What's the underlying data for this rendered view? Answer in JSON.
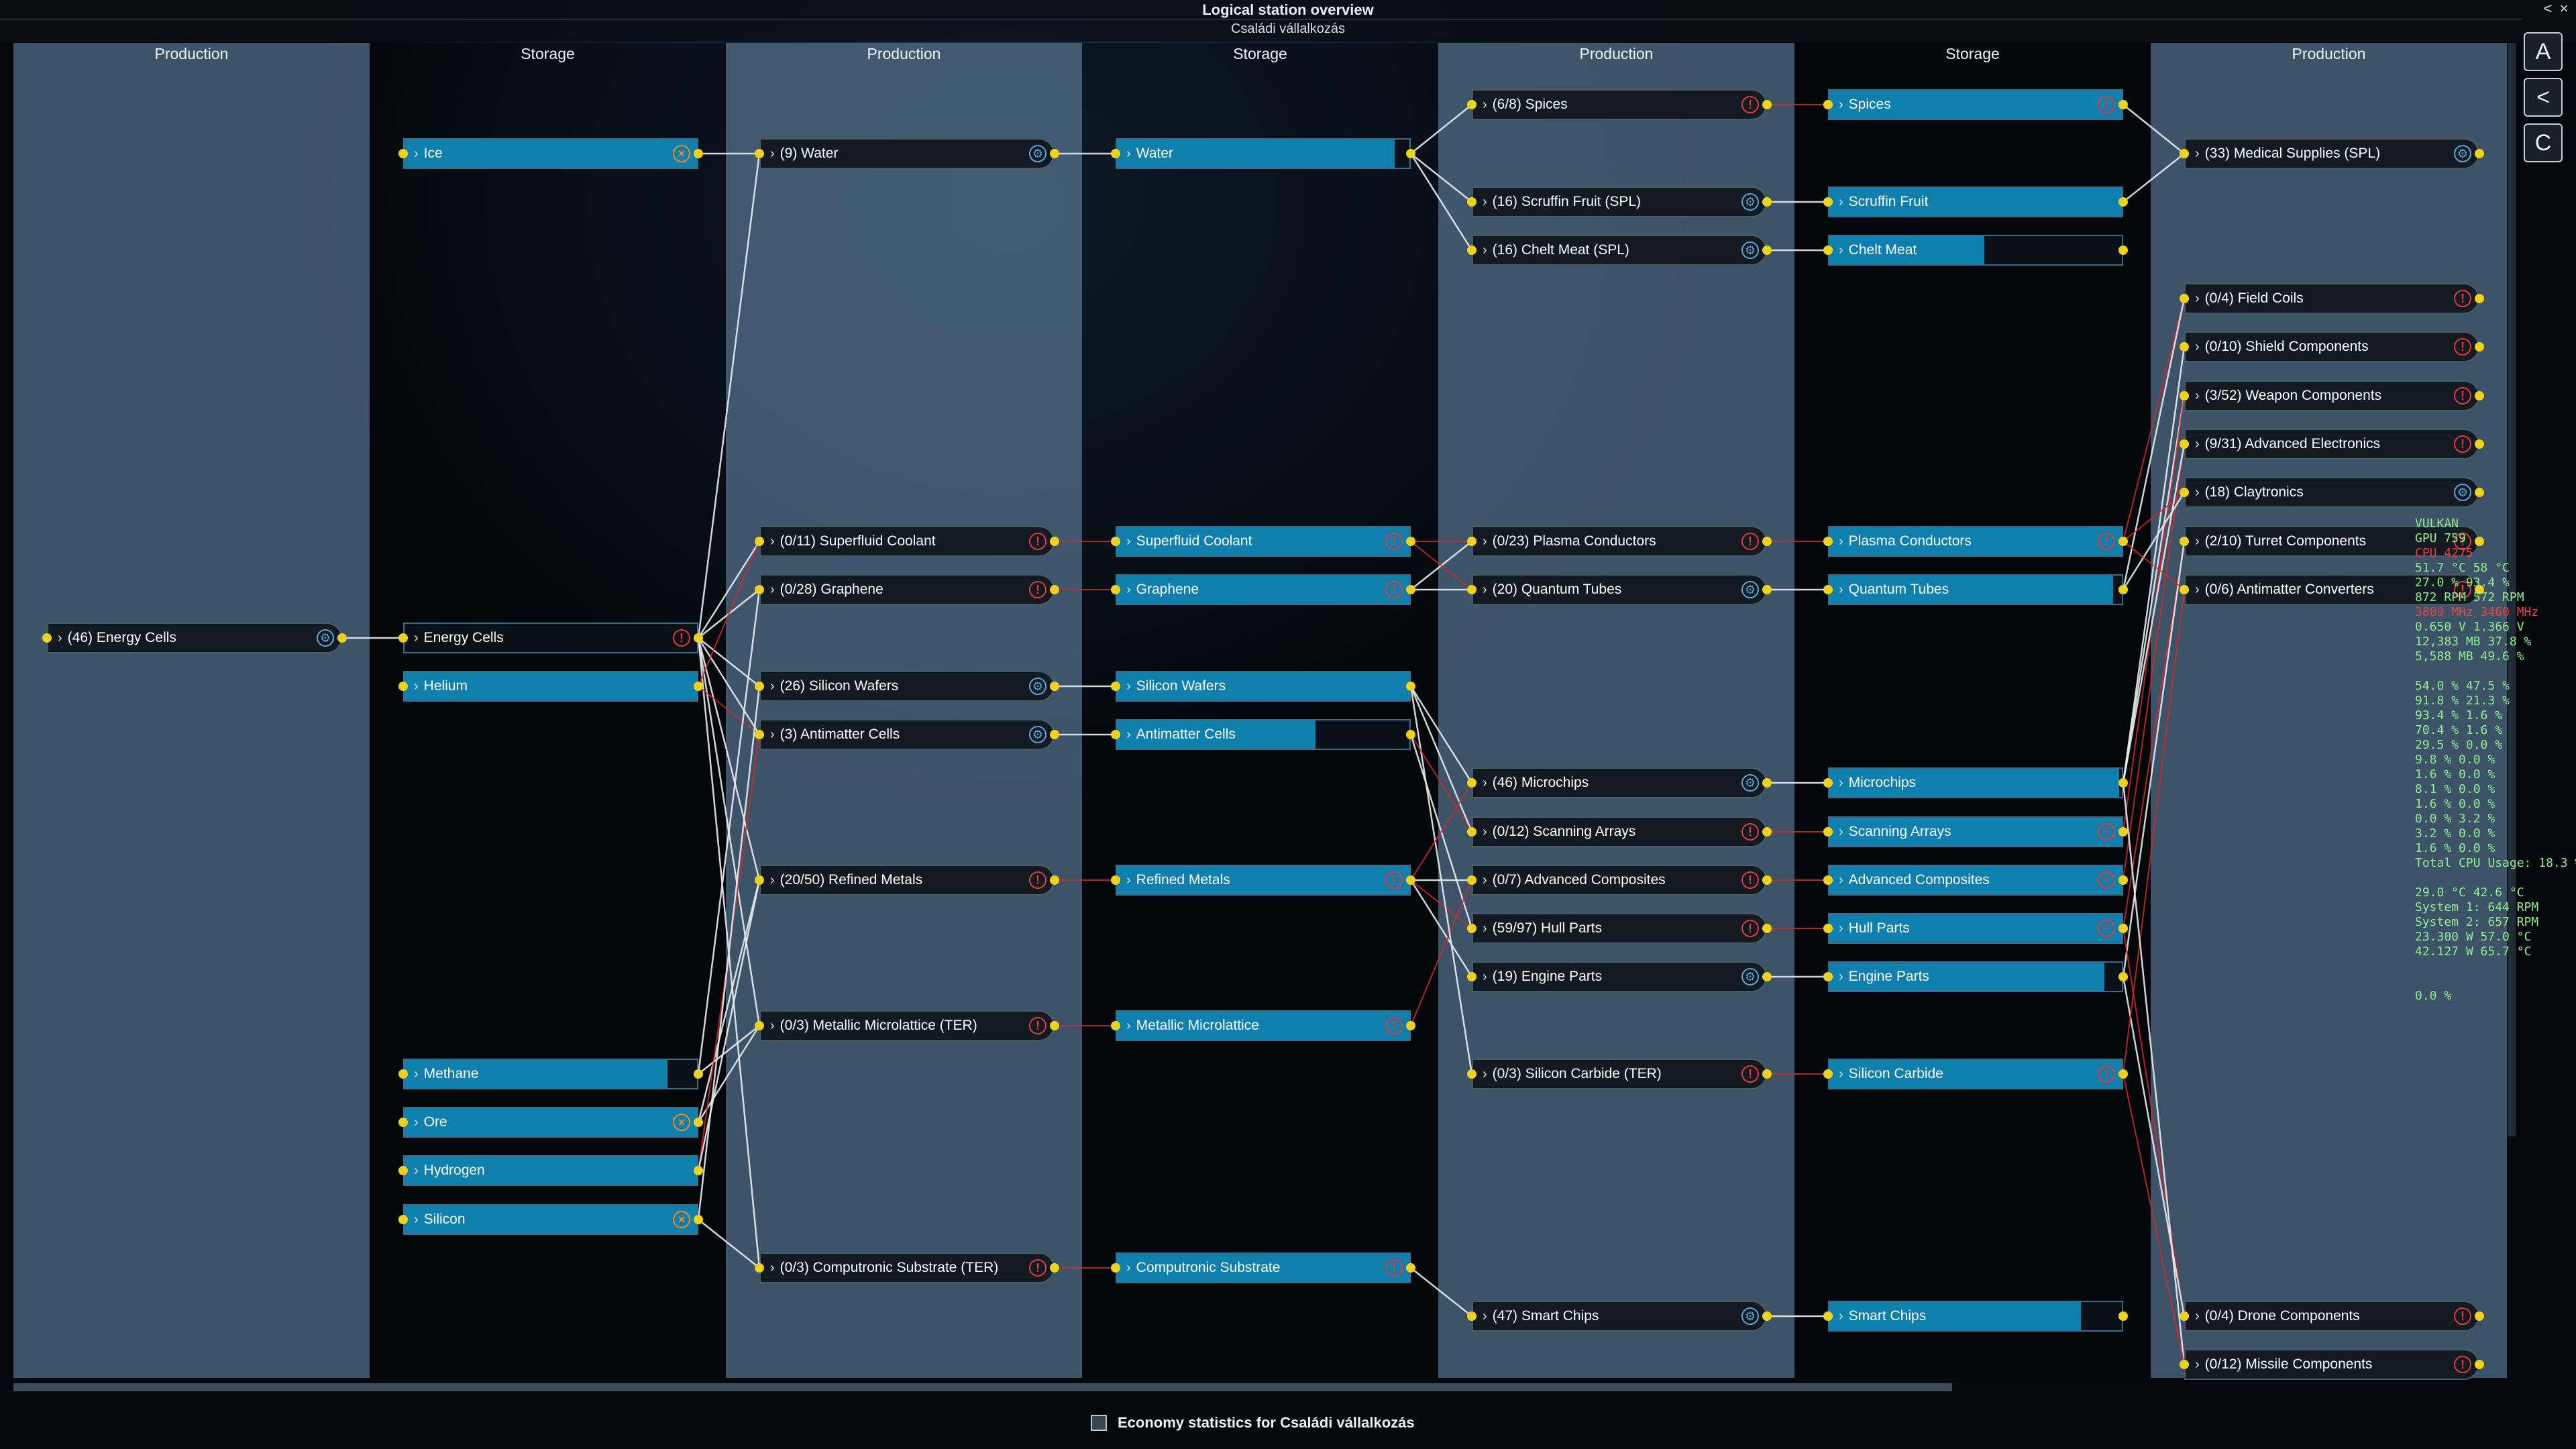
{
  "window": {
    "title": "Logical station overview",
    "subtitle": "Családi vállalkozás",
    "back_glyph": "<",
    "close_glyph": "×"
  },
  "columns": [
    {
      "label": "Production"
    },
    {
      "label": "Storage"
    },
    {
      "label": "Production"
    },
    {
      "label": "Storage"
    },
    {
      "label": "Production"
    },
    {
      "label": "Storage"
    },
    {
      "label": "Production"
    }
  ],
  "nodes": [
    {
      "label": "(46) Energy Cells",
      "status": "ok"
    },
    {
      "label": "Ice",
      "status": "x",
      "fill": 1.0
    },
    {
      "label": "Energy Cells",
      "status": "err",
      "fill": 0.0
    },
    {
      "label": "Helium",
      "status": "none",
      "fill": 1.0
    },
    {
      "label": "Methane",
      "status": "none",
      "fill": 0.9
    },
    {
      "label": "Ore",
      "status": "x",
      "fill": 1.0
    },
    {
      "label": "Hydrogen",
      "status": "none",
      "fill": 1.0
    },
    {
      "label": "Silicon",
      "status": "x",
      "fill": 1.0
    },
    {
      "label": "(9) Water",
      "status": "ok"
    },
    {
      "label": "(0/11) Superfluid Coolant",
      "status": "err"
    },
    {
      "label": "(0/28) Graphene",
      "status": "err"
    },
    {
      "label": "(26) Silicon Wafers",
      "status": "ok"
    },
    {
      "label": "(3) Antimatter Cells",
      "status": "ok"
    },
    {
      "label": "(20/50) Refined Metals",
      "status": "err"
    },
    {
      "label": "(0/3) Metallic Microlattice (TER)",
      "status": "err"
    },
    {
      "label": "(0/3) Computronic Substrate (TER)",
      "status": "err"
    },
    {
      "label": "Water",
      "status": "none",
      "fill": 0.95
    },
    {
      "label": "Superfluid Coolant",
      "status": "err",
      "fill": 1.0
    },
    {
      "label": "Graphene",
      "status": "err",
      "fill": 1.0
    },
    {
      "label": "Silicon Wafers",
      "status": "none",
      "fill": 1.0
    },
    {
      "label": "Antimatter Cells",
      "status": "none",
      "fill": 0.68
    },
    {
      "label": "Refined Metals",
      "status": "err",
      "fill": 1.0
    },
    {
      "label": "Metallic Microlattice",
      "status": "err",
      "fill": 1.0
    },
    {
      "label": "Computronic Substrate",
      "status": "err",
      "fill": 1.0
    },
    {
      "label": "(6/8) Spices",
      "status": "err"
    },
    {
      "label": "(16) Scruffin Fruit (SPL)",
      "status": "ok"
    },
    {
      "label": "(16) Chelt Meat (SPL)",
      "status": "ok"
    },
    {
      "label": "(0/23) Plasma Conductors",
      "status": "err"
    },
    {
      "label": "(20) Quantum Tubes",
      "status": "ok"
    },
    {
      "label": "(46) Microchips",
      "status": "ok"
    },
    {
      "label": "(0/12) Scanning Arrays",
      "status": "err"
    },
    {
      "label": "(0/7) Advanced Composites",
      "status": "err"
    },
    {
      "label": "(59/97) Hull Parts",
      "status": "err"
    },
    {
      "label": "(19) Engine Parts",
      "status": "ok"
    },
    {
      "label": "(0/3) Silicon Carbide (TER)",
      "status": "err"
    },
    {
      "label": "(47) Smart Chips",
      "status": "ok"
    },
    {
      "label": "Spices",
      "status": "err",
      "fill": 1.0
    },
    {
      "label": "Scruffin Fruit",
      "status": "none",
      "fill": 1.0
    },
    {
      "label": "Chelt Meat",
      "status": "none",
      "fill": 0.53
    },
    {
      "label": "Plasma Conductors",
      "status": "err",
      "fill": 1.0
    },
    {
      "label": "Quantum Tubes",
      "status": "none",
      "fill": 0.97
    },
    {
      "label": "Microchips",
      "status": "none",
      "fill": 0.99
    },
    {
      "label": "Scanning Arrays",
      "status": "err",
      "fill": 1.0
    },
    {
      "label": "Advanced Composites",
      "status": "err",
      "fill": 1.0
    },
    {
      "label": "Hull Parts",
      "status": "err",
      "fill": 1.0
    },
    {
      "label": "Engine Parts",
      "status": "none",
      "fill": 0.94
    },
    {
      "label": "Silicon Carbide",
      "status": "err",
      "fill": 1.0
    },
    {
      "label": "Smart Chips",
      "status": "none",
      "fill": 0.86
    },
    {
      "label": "(33) Medical Supplies (SPL)",
      "status": "ok"
    },
    {
      "label": "(0/4) Field Coils",
      "status": "err"
    },
    {
      "label": "(0/10) Shield Components",
      "status": "err"
    },
    {
      "label": "(3/52) Weapon Components",
      "status": "err"
    },
    {
      "label": "(9/31) Advanced Electronics",
      "status": "err"
    },
    {
      "label": "(18) Claytronics",
      "status": "ok"
    },
    {
      "label": "(2/10) Turret Components",
      "status": "err"
    },
    {
      "label": "(0/6) Antimatter Converters",
      "status": "err"
    },
    {
      "label": "(0/4) Drone Components",
      "status": "err"
    },
    {
      "label": "(0/12) Missile Components",
      "status": "err"
    }
  ],
  "side_buttons": [
    {
      "name": "autopilot-button",
      "glyph": "A"
    },
    {
      "name": "share-button",
      "glyph": "<"
    },
    {
      "name": "credits-button",
      "glyph": "C"
    }
  ],
  "overlay": {
    "title": "VULKAN",
    "lines": [
      "GPU     759",
      "CPU    4275",
      "51.7 °C 58 °C",
      "27.0 % 93.4 %",
      "872 RPM 572 RPM",
      "3809 MHz 3460 MHz",
      "0.650 V 1.366 V",
      "12,383 MB 37.8 %",
      "5,588 MB 49.6 %",
      "",
      "54.0 % 47.5 %",
      "91.8 % 21.3 %",
      "93.4 % 1.6 %",
      "70.4 % 1.6 %",
      "29.5 % 0.0 %",
      "9.8 % 0.0 %",
      "1.6 % 0.0 %",
      "8.1 % 0.0 %",
      "1.6 % 0.0 %",
      "0.0 % 3.2 %",
      "3.2 % 0.0 %",
      "1.6 % 0.0 %",
      "Total CPU Usage: 18.3 %",
      "",
      "29.0 °C 42.6 °C",
      "System 1: 644 RPM",
      "System 2: 657 RPM",
      "23.300 W 57.0 °C",
      "42.127 W 65.7 °C",
      "",
      "",
      "0.0 %"
    ]
  },
  "footer": {
    "checkbox_label": "Economy statistics for Családi vállalkozás",
    "checked": false
  },
  "colors": {
    "production_column": "#4a647c",
    "storage_column": "#050709",
    "storage_fill": "#0f7fae",
    "error": "#e23a3a",
    "ok": "#5aa6d8",
    "warning": "#f08a1c",
    "link_dot": "#f1d21b"
  }
}
